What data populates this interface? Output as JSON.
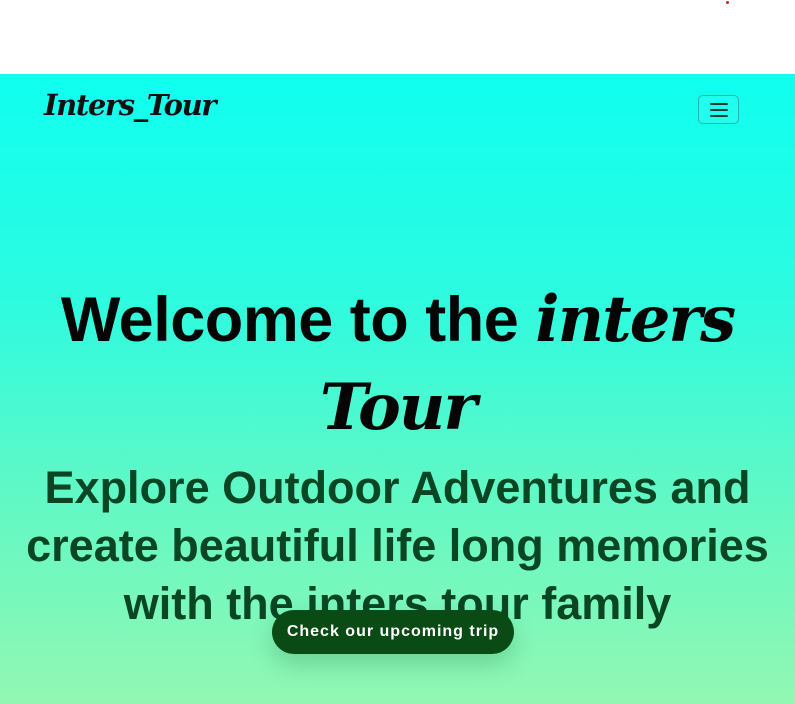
{
  "navbar": {
    "brand": "Inters_Tour",
    "toggle_icon": "hamburger-menu-icon"
  },
  "hero": {
    "headline_prefix": "Welcome to the",
    "headline_line1_script": "inters",
    "headline_line2_script": "Tour",
    "subheadline": "Explore Outdoor Adventures and create beautiful life long memories with the inters tour family",
    "cta_label": "Check our upcoming trip"
  },
  "colors": {
    "gradient_top": "#10fff0",
    "gradient_bottom": "#93f7b3",
    "cta_background": "#0a4a14",
    "subheadline_text": "#0a4524"
  }
}
